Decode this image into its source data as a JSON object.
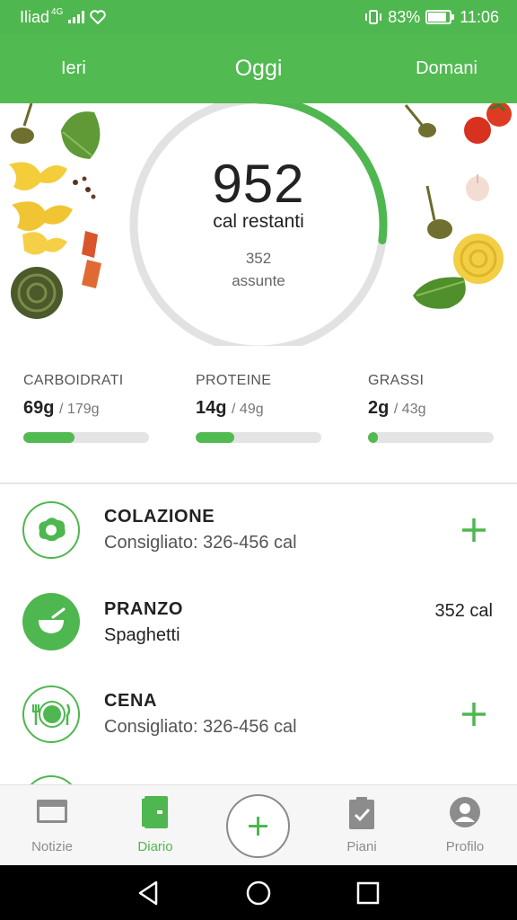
{
  "status_bar": {
    "carrier": "Iliad",
    "network": "4G",
    "battery": "83%",
    "time": "11:06"
  },
  "nav": {
    "prev": "Ieri",
    "current": "Oggi",
    "next": "Domani"
  },
  "summary": {
    "remaining": "952",
    "remaining_label": "cal restanti",
    "eaten": "352",
    "eaten_label": "assunte",
    "progress": 0.27
  },
  "macros": [
    {
      "title": "CARBOIDRATI",
      "current": "69g",
      "goal": "/ 179g",
      "progress": 0.41
    },
    {
      "title": "PROTEINE",
      "current": "14g",
      "goal": "/ 49g",
      "progress": 0.31
    },
    {
      "title": "GRASSI",
      "current": "2g",
      "goal": "/ 43g",
      "progress": 0.05
    }
  ],
  "meals": [
    {
      "name": "COLAZIONE",
      "subtitle": "Consigliato: 326-456 cal",
      "icon": "fried-egg-icon",
      "action": "+"
    },
    {
      "name": "PRANZO",
      "subtitle": "Spaghetti",
      "icon": "bowl-icon",
      "calories": "352 cal"
    },
    {
      "name": "CENA",
      "subtitle": "Consigliato: 326-456 cal",
      "icon": "plate-cutlery-icon",
      "action": "+"
    }
  ],
  "tabs": [
    {
      "label": "Notizie",
      "icon": "news-icon"
    },
    {
      "label": "Diario",
      "icon": "diary-icon",
      "active": true
    },
    {
      "label": "Piani",
      "icon": "clipboard-icon"
    },
    {
      "label": "Profilo",
      "icon": "profile-icon"
    }
  ],
  "colors": {
    "brand_green": "#4fb74f",
    "ring_track": "#e2e2e2",
    "inactive_gray": "#8c8c8c"
  }
}
